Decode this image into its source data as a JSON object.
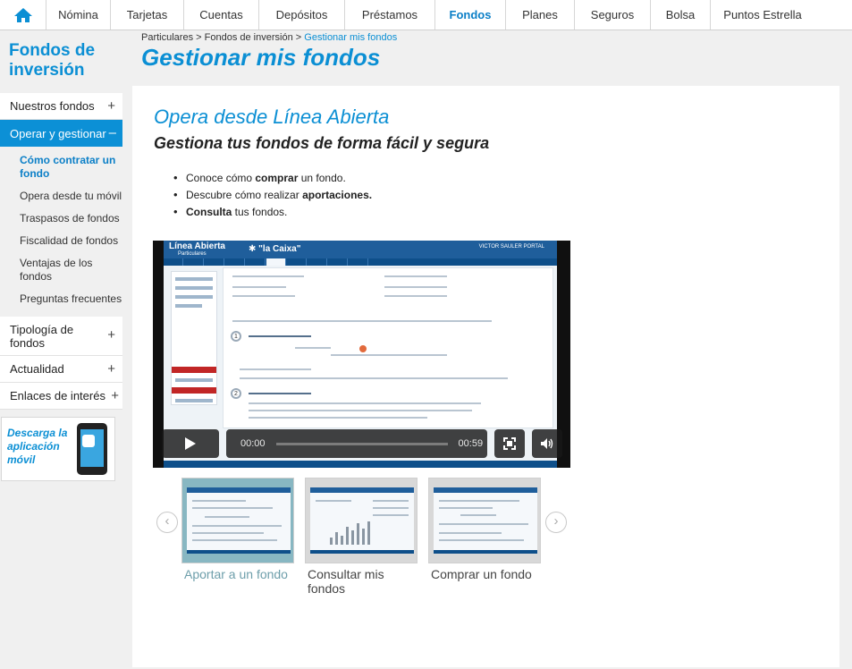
{
  "nav": {
    "items": [
      "Nómina",
      "Tarjetas",
      "Cuentas",
      "Depósitos",
      "Préstamos",
      "Fondos",
      "Planes",
      "Seguros",
      "Bolsa",
      "Puntos Estrella"
    ],
    "active": "Fondos",
    "accent": "#0b8fd4"
  },
  "sidebar": {
    "title_line1": "Fondos de",
    "title_line2": "inversión",
    "items": [
      {
        "label": "Nuestros fondos",
        "sign": "+"
      },
      {
        "label": "Operar y gestionar",
        "sign": "–"
      },
      {
        "label": "Tipología de fondos",
        "sign": "+"
      },
      {
        "label": "Actualidad",
        "sign": "+"
      },
      {
        "label": "Enlaces de interés",
        "sign": "+"
      }
    ],
    "subitems": [
      "Cómo contratar un fondo",
      "Opera desde tu móvil",
      "Traspasos de fondos",
      "Fiscalidad de fondos",
      "Ventajas de los fondos",
      "Preguntas frecuentes"
    ],
    "promo_line1": "Descarga la",
    "promo_line2": "aplicación",
    "promo_line3": "móvil"
  },
  "header": {
    "breadcrumb": [
      "Particulares",
      "Fondos de inversión",
      "Gestionar mis fondos"
    ],
    "separator": ">",
    "title": "Gestionar mis fondos"
  },
  "content": {
    "title": "Opera desde Línea Abierta",
    "subtitle": "Gestiona tus fondos de forma fácil y segura",
    "bullets": [
      {
        "pre": "Conoce cómo ",
        "bold": "comprar",
        "post": " un fondo."
      },
      {
        "pre": "Descubre cómo realizar ",
        "bold": "aportaciones.",
        "post": ""
      },
      {
        "pre": "",
        "bold": "Consulta",
        "post": " tus fondos."
      }
    ]
  },
  "video": {
    "app_name": "Línea Abierta",
    "app_sub": "Particulares",
    "brand": "\"la Caixa\"",
    "user": "VICTOR SAULER PORTAL",
    "time_current": "00:00",
    "time_total": "00:59"
  },
  "carousel": {
    "items": [
      {
        "label": "Aportar a un fondo",
        "selected": true
      },
      {
        "label": "Consultar mis fondos",
        "selected": false
      },
      {
        "label": "Comprar un fondo",
        "selected": false
      }
    ]
  }
}
